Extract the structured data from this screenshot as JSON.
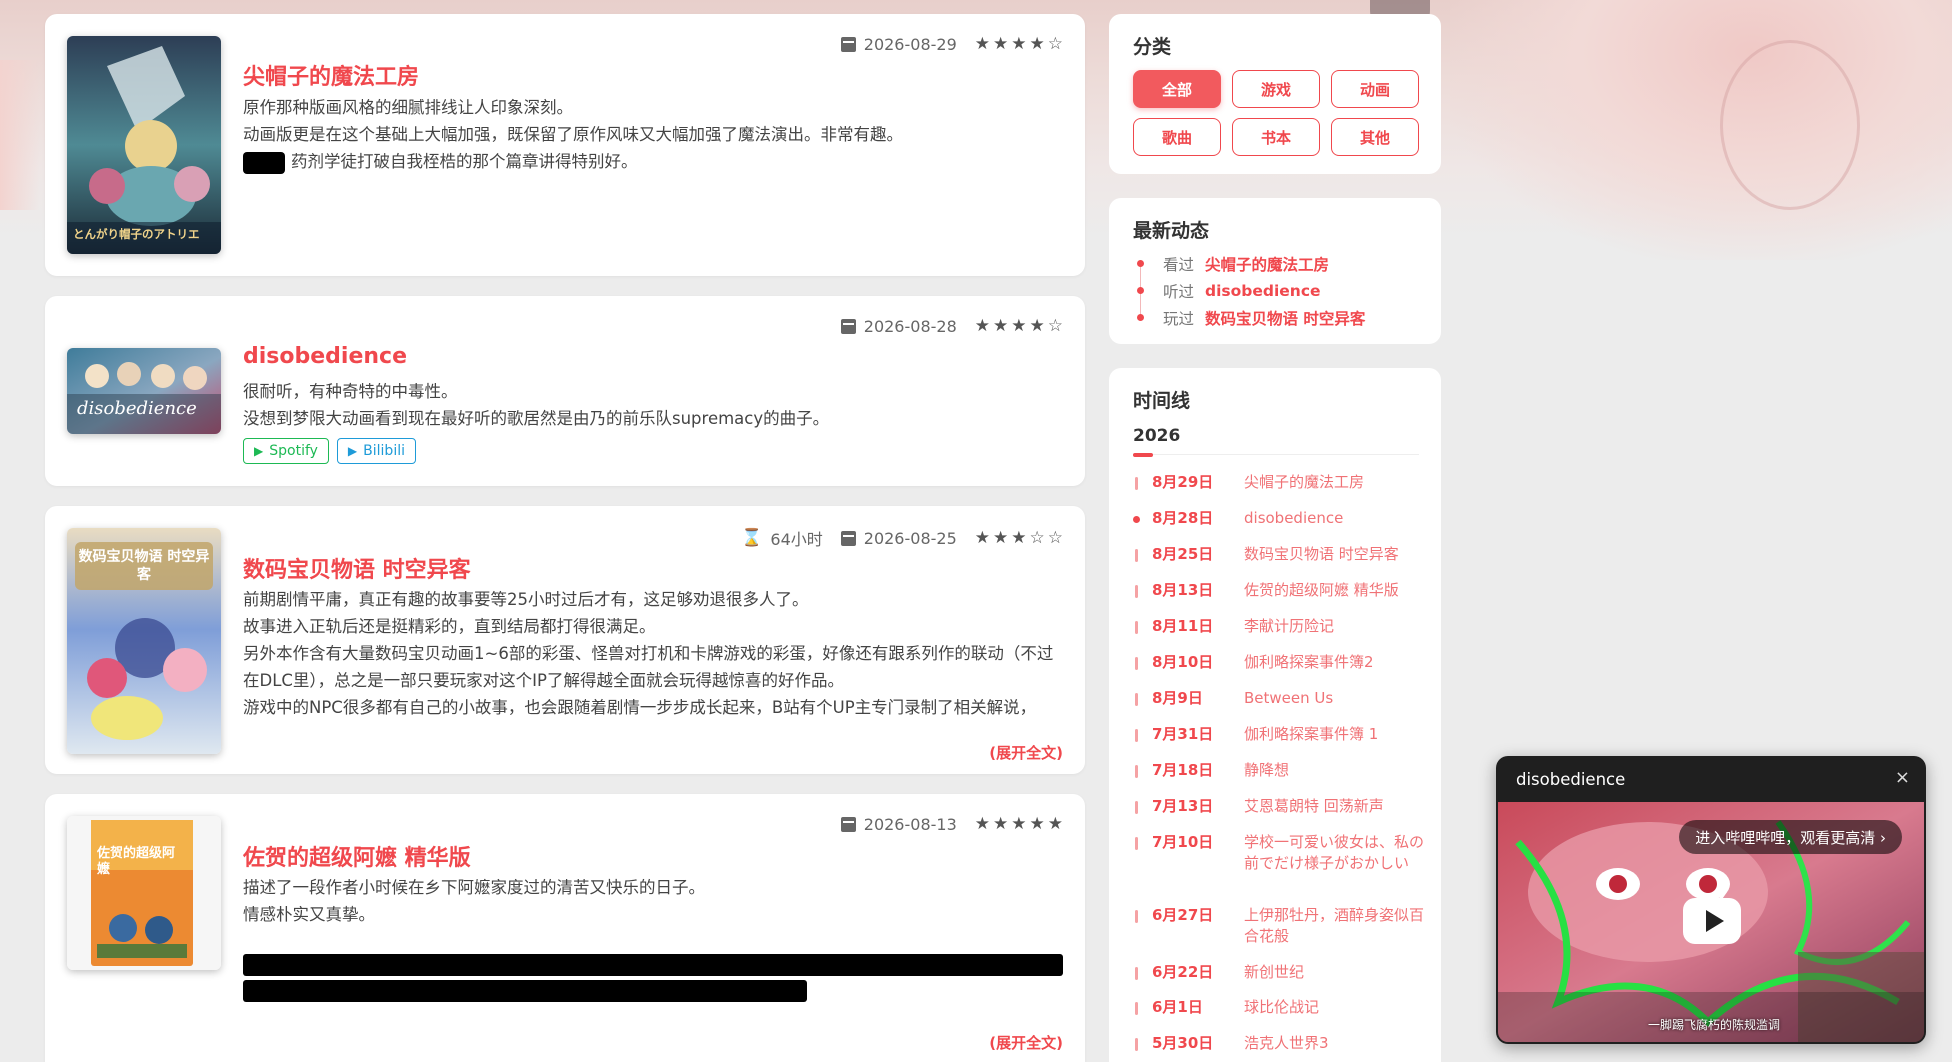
{
  "feed": [
    {
      "title": "尖帽子的魔法工房",
      "date": "2026-08-29",
      "rating": 4,
      "lines": [
        "原作那种版画风格的细腻排线让人印象深刻。",
        "动画版更是在这个基础上大幅加强，既保留了原作风味又大幅加强了魔法演出。非常有趣。",
        "药剂学徒打破自我桎梏的那个篇章讲得特别好。"
      ],
      "cover_label": "とんがり帽子のアトリエ",
      "cover_colors": [
        "#2a4a5a",
        "#7bb6c0",
        "#e7d08a"
      ]
    },
    {
      "title": "disobedience",
      "date": "2026-08-28",
      "rating": 4,
      "lines": [
        "很耐听，有种奇特的中毒性。",
        "没想到梦限大动画看到现在最好听的歌居然是由乃的前乐队supremacy的曲子。"
      ],
      "links": [
        {
          "label": "Spotify"
        },
        {
          "label": "Bilibili"
        }
      ],
      "cover_label": "disobedience",
      "cover_colors": [
        "#3a8aa8",
        "#c4456a",
        "#f0e0c0"
      ]
    },
    {
      "title": "数码宝贝物语 时空异客",
      "date": "2026-08-25",
      "hours": "64小时",
      "rating": 3,
      "lines": [
        "前期剧情平庸，真正有趣的故事要等25小时过后才有，这足够劝退很多人了。",
        "故事进入正轨后还是挺精彩的，直到结局都打得很满足。",
        "另外本作含有大量数码宝贝动画1~6部的彩蛋、怪兽对打机和卡牌游戏的彩蛋，好像还有跟系列作的联动（不过在DLC里），总之是一部只要玩家对这个IP了解得越全面就会玩得越惊喜的好作品。",
        "游戏中的NPC很多都有自己的小故事，也会跟随着剧情一步步成长起来，B站有个UP主专门录制了相关解说，"
      ],
      "more": "(展开全文)",
      "cover_label": "数码宝贝物语 时空异客",
      "cover_colors": [
        "#d8c8a8",
        "#5e7fc8",
        "#e05a7a"
      ]
    },
    {
      "title": "佐贺的超级阿嬷 精华版",
      "date": "2026-08-13",
      "rating": 5,
      "lines": [
        "描述了一段作者小时候在乡下阿嬷家度过的清苦又快乐的日子。",
        "情感朴实又真挚。"
      ],
      "more": "(展开全文)",
      "cover_label": "佐贺的超级阿嬷",
      "cover_colors": [
        "#e87a2a",
        "#f3b64a",
        "#3a6aa0"
      ]
    }
  ],
  "categories": {
    "title": "分类",
    "items": [
      "全部",
      "游戏",
      "动画",
      "歌曲",
      "书本",
      "其他"
    ],
    "active": 0
  },
  "recent": {
    "title": "最新动态",
    "items": [
      {
        "verb": "看过",
        "object": "尖帽子的魔法工房"
      },
      {
        "verb": "听过",
        "object": "disobedience"
      },
      {
        "verb": "玩过",
        "object": "数码宝贝物语 时空异客"
      }
    ]
  },
  "timeline": {
    "title": "时间线",
    "year": "2026",
    "items": [
      {
        "date": "8月29日",
        "name": "尖帽子的魔法工房"
      },
      {
        "date": "8月28日",
        "name": "disobedience",
        "current": true
      },
      {
        "date": "8月25日",
        "name": "数码宝贝物语 时空异客"
      },
      {
        "date": "8月13日",
        "name": "佐贺的超级阿嬷 精华版"
      },
      {
        "date": "8月11日",
        "name": "李献计历险记"
      },
      {
        "date": "8月10日",
        "name": "伽利略探案事件簿2"
      },
      {
        "date": "8月9日",
        "name": "Between Us"
      },
      {
        "date": "7月31日",
        "name": "伽利略探案事件簿 1"
      },
      {
        "date": "7月18日",
        "name": "静降想"
      },
      {
        "date": "7月13日",
        "name": "艾恩葛朗特 回荡新声"
      },
      {
        "date": "7月10日",
        "name": "学校一可爱い彼女は、私の前でだけ様子がおかしい"
      },
      {
        "date": "6月27日",
        "name": "上伊那牡丹，酒醉身姿似百合花般"
      },
      {
        "date": "6月22日",
        "name": "新创世纪"
      },
      {
        "date": "6月1日",
        "name": "球比伦战记"
      },
      {
        "date": "5月30日",
        "name": "浩克人世界3"
      }
    ]
  },
  "player": {
    "title": "disobedience",
    "close": "×",
    "hint": "进入哔哩哔哩，观看更高清 ›",
    "caption": "一脚踢飞腐朽的陈规滥调"
  },
  "stars": {
    "filled": "★",
    "empty": "☆"
  },
  "colors": {
    "accent": "#f0484d",
    "spotify": "#1db954",
    "bilibili": "#1e9bd8"
  }
}
